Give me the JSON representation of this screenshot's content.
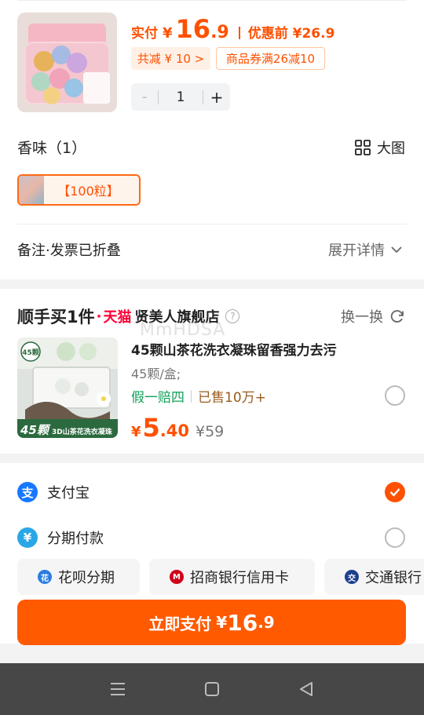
{
  "product": {
    "price_label": "实付",
    "currency": "¥",
    "price_int": "16",
    "price_dec": ".9",
    "original_label": "优惠前 ¥26.9",
    "discount_chip": "共减 ¥ 10 >",
    "coupon_chip": "商品券满26减10",
    "quantity": "1",
    "minus": "-",
    "plus": "+"
  },
  "sku": {
    "section_title": "香味（1）",
    "big_view_label": "大图",
    "selected_option": "【100粒】"
  },
  "note": {
    "label": "备注·发票已折叠",
    "expand_label": "展开详情"
  },
  "addon": {
    "title_prefix": "顺手买1件",
    "dot": "·",
    "tmall_label": "天猫",
    "shop_name": "贤美人旗舰店",
    "swap_label": "换一换",
    "product_title": "45颗山茶花洗衣凝珠留香强力去污",
    "spec": "45颗/盒;",
    "guarantee": "假一赔四",
    "sold": "已售10万+",
    "currency": "¥",
    "price_int": "5",
    "price_dec": ".40",
    "original_price": "¥59",
    "img_badge_count": "45颗",
    "img_badge_caption": "3D山茶花洗衣凝珠",
    "img_corner": "45颗",
    "selected": false
  },
  "watermark": "MmHDSA",
  "payment": {
    "alipay": {
      "label": "支付宝",
      "logo": "支",
      "selected": true
    },
    "installment": {
      "label": "分期付款",
      "logo": "¥",
      "selected": false
    },
    "options": [
      {
        "label": "花呗分期",
        "icon": "huabei-icon"
      },
      {
        "label": "招商银行信用卡",
        "icon": "cmb-icon"
      },
      {
        "label": "交通银行",
        "icon": "bocom-icon"
      }
    ],
    "pay_button": {
      "label": "立即支付",
      "currency": "¥",
      "price_int": "16",
      "price_dec": ".9"
    }
  },
  "colors": {
    "accent": "#ff5000",
    "tmall": "#ff0036",
    "alipay": "#1677ff",
    "guarantee": "#14a05a"
  }
}
